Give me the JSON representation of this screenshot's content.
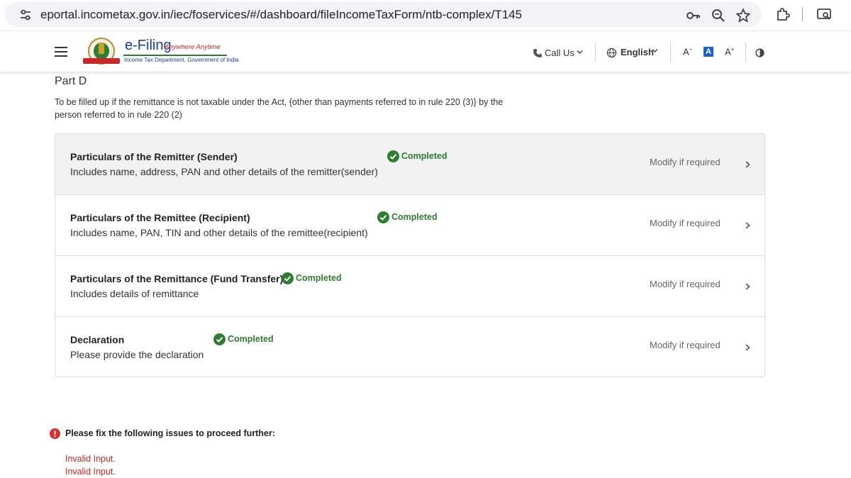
{
  "browser": {
    "url": "eportal.incometax.gov.in/iec/foservices/#/dashboard/fileIncomeTaxForm/ntb-complex/T145"
  },
  "header": {
    "logo_title": "e-Filing",
    "logo_tagline": "Anywhere Anytime",
    "logo_subtitle": "Income Tax Department, Government of India",
    "call_us": "Call Us",
    "language": "English",
    "font_decrease": "A",
    "font_default": "A",
    "font_increase": "A"
  },
  "part": {
    "title": "Part D",
    "description": "To be filled up if the remittance is not taxable under the Act, {other than payments referred to in rule 220 (3)} by the person referred to in rule 220 (2)"
  },
  "sections": [
    {
      "title": "Particulars of the Remitter (Sender)",
      "subtitle": "Includes name, address, PAN and other details of the remitter(sender)",
      "status": "Completed",
      "action": "Modify if required"
    },
    {
      "title": "Particulars of the Remittee (Recipient)",
      "subtitle": "Includes name, PAN, TIN and other details of the remittee(recipient)",
      "status": "Completed",
      "action": "Modify if required"
    },
    {
      "title": "Particulars of the Remittance (Fund Transfer)",
      "subtitle": "Includes details of remittance",
      "status": "Completed",
      "action": "Modify if required"
    },
    {
      "title": "Declaration",
      "subtitle": "Please provide the declaration",
      "status": "Completed",
      "action": "Modify if required"
    }
  ],
  "errors": {
    "heading": "Please fix the following issues to proceed further:",
    "items": [
      "Invalid Input.",
      "Invalid Input."
    ]
  },
  "colors": {
    "success": "#2e7d32",
    "error": "#c62828",
    "brand_blue": "#1d3f8f",
    "active_font_control": "#1e64c8"
  },
  "icons": {
    "url_bar": [
      "tune-icon",
      "key-icon",
      "zoom-icon",
      "star-icon"
    ],
    "toolbar": [
      "extensions-icon",
      "screen-search-icon"
    ],
    "header": [
      "menu-icon",
      "phone-icon",
      "globe-icon",
      "contrast-icon"
    ],
    "status": "check-circle-icon",
    "error": "error-icon"
  }
}
